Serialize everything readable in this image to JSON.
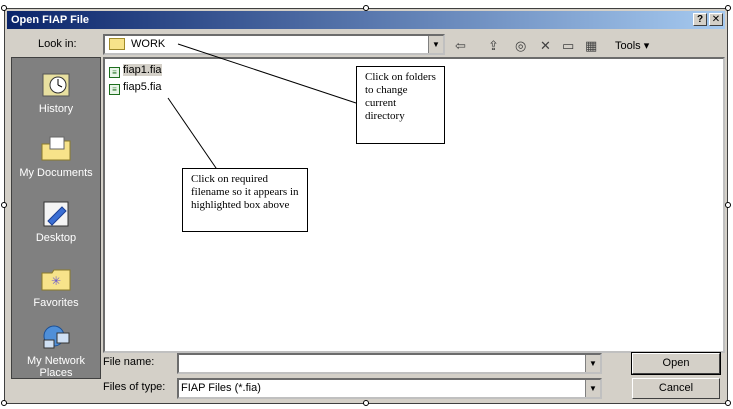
{
  "window": {
    "title": "Open FIAP File",
    "help_label": "?",
    "close_label": "✕"
  },
  "lookin": {
    "label": "Look in:",
    "value": "WORK"
  },
  "toolbar": {
    "tools_label": "Tools ▾"
  },
  "places": [
    {
      "label": "History",
      "icon": "history-icon"
    },
    {
      "label": "My Documents",
      "icon": "my-documents-icon"
    },
    {
      "label": "Desktop",
      "icon": "desktop-icon"
    },
    {
      "label": "Favorites",
      "icon": "favorites-icon"
    },
    {
      "label": "My Network Places",
      "icon": "network-places-icon"
    }
  ],
  "files": [
    {
      "name": "fiap1.fia"
    },
    {
      "name": "fiap5.fia"
    }
  ],
  "annotations": {
    "folders_note": "Click on folders to change current directory",
    "filename_note": "Click on required filename so it appears in highlighted box above"
  },
  "filename": {
    "label": "File name:",
    "value": ""
  },
  "filetype": {
    "label": "Files of type:",
    "value": "FIAP Files (*.fia)"
  },
  "buttons": {
    "open": "Open",
    "cancel": "Cancel"
  }
}
